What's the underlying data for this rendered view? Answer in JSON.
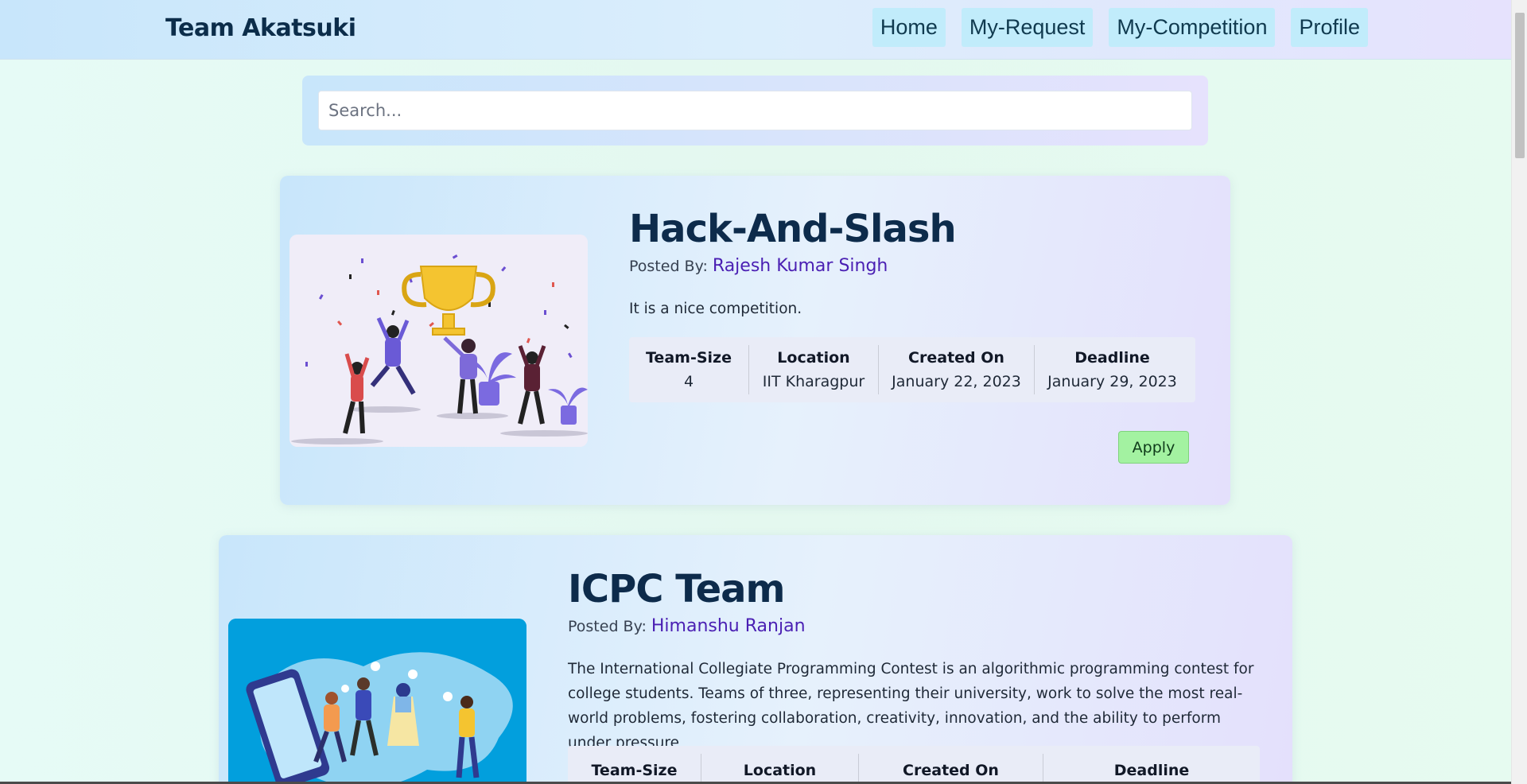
{
  "navbar": {
    "brand": "Team Akatsuki",
    "links": [
      "Home",
      "My-Request",
      "My-Competition",
      "Profile"
    ]
  },
  "search": {
    "placeholder": "Search..."
  },
  "stat_labels": [
    "Team-Size",
    "Location",
    "Created On",
    "Deadline"
  ],
  "cards": [
    {
      "title": "Hack-And-Slash",
      "posted_prefix": "Posted By:",
      "author": "Rajesh Kumar Singh",
      "description": "It is a nice competition.",
      "team_size": "4",
      "location": "IIT Kharagpur",
      "created_on": "January 22, 2023",
      "deadline": "January 29, 2023",
      "apply_label": "Apply"
    },
    {
      "title": "ICPC Team",
      "posted_prefix": "Posted By:",
      "author": "Himanshu Ranjan",
      "description": "The International Collegiate Programming Contest is an algorithmic programming contest for college students. Teams of three, representing their university, work to solve the most real-world problems, fostering collaboration, creativity, innovation, and the ability to perform under pressure"
    }
  ],
  "colors": {
    "accent_author": "#4a1fb3",
    "apply_green": "#a3f2a1",
    "nav_button": "#c1ecfb",
    "title_navy": "#0d2b4b"
  }
}
